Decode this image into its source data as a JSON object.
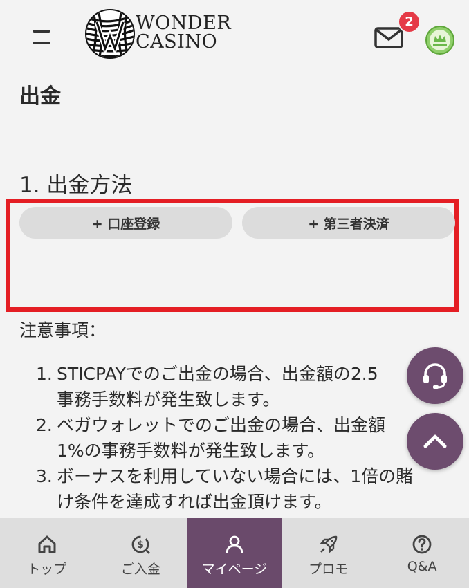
{
  "header": {
    "logo_line1": "WONDER",
    "logo_line2": "CASINO",
    "notification_count": "2",
    "icons": {
      "menu": "hamburger-icon",
      "mail": "mail-icon",
      "avatar": "rank-avatar-icon"
    }
  },
  "page": {
    "title": "出金",
    "section_title": "1. 出金方法"
  },
  "methods": {
    "account_register": "+ 口座登録",
    "third_party": "+ 第三者決済"
  },
  "notes": {
    "title": "注意事項：",
    "items": [
      {
        "num": "1.",
        "line1": "STICPAYでのご出金の場合、出金額の2.5",
        "line2": "事務手数料が発生致します。"
      },
      {
        "num": "2.",
        "line1": "ベガウォレットでのご出金の場合、出金額",
        "line2": "1%の事務手数料が発生致します。"
      },
      {
        "num": "3.",
        "line1": "ボーナスを利用していない場合には、1倍の賭",
        "line2": "け条件を達成すれば出金頂けます。"
      }
    ]
  },
  "fabs": {
    "support": "headset-icon",
    "scroll_top": "chevron-up-icon"
  },
  "nav": {
    "items": [
      {
        "label": "トップ",
        "icon": "home-icon"
      },
      {
        "label": "ご入金",
        "icon": "deposit-icon"
      },
      {
        "label": "マイページ",
        "icon": "user-icon"
      },
      {
        "label": "プロモ",
        "icon": "rocket-icon"
      },
      {
        "label": "Q&A",
        "icon": "question-icon"
      }
    ],
    "active_index": 2
  },
  "colors": {
    "background": "#f3f3f3",
    "accent_purple": "#6a4a6b",
    "highlight_red": "#e41e24",
    "badge_red": "#e53a47",
    "button_gray": "#dcdcdc",
    "nav_gray": "#dedede"
  }
}
